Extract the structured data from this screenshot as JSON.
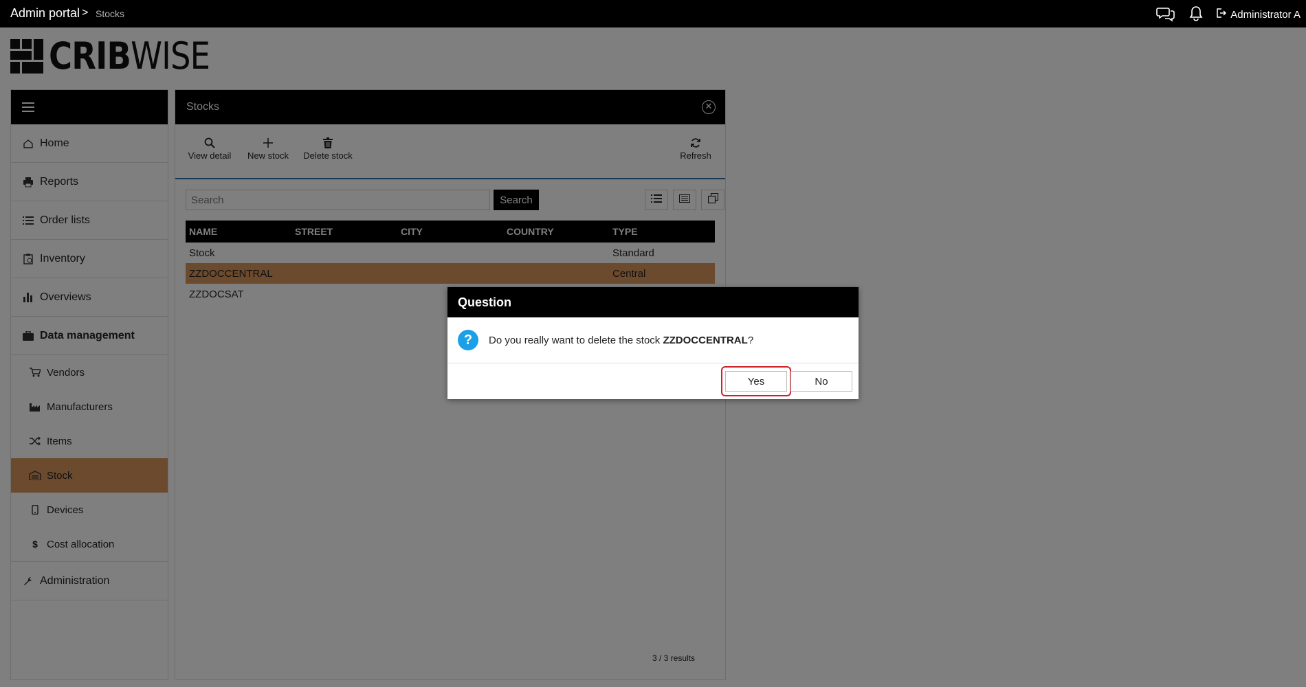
{
  "topbar": {
    "breadcrumb_root": "Admin portal",
    "breadcrumb_sep": ">",
    "breadcrumb_current": "Stocks",
    "user_name": "Administrator A",
    "icons": [
      "chat-icon",
      "bell-icon",
      "logout-icon"
    ]
  },
  "logo": {
    "bold": "CRIB",
    "light": "WISE"
  },
  "sidebar": {
    "items": [
      {
        "label": "Home",
        "icon": "home-icon"
      },
      {
        "label": "Reports",
        "icon": "printer-icon"
      },
      {
        "label": "Order lists",
        "icon": "list-icon"
      },
      {
        "label": "Inventory",
        "icon": "clipboard-icon"
      },
      {
        "label": "Overviews",
        "icon": "bar-chart-icon"
      },
      {
        "label": "Data management",
        "icon": "briefcase-icon"
      }
    ],
    "sub_items": [
      {
        "label": "Vendors",
        "icon": "cart-icon"
      },
      {
        "label": "Manufacturers",
        "icon": "factory-icon"
      },
      {
        "label": "Items",
        "icon": "shuffle-icon"
      },
      {
        "label": "Stock",
        "icon": "warehouse-icon"
      },
      {
        "label": "Devices",
        "icon": "mobile-icon"
      },
      {
        "label": "Cost allocation",
        "icon": "dollar-icon"
      }
    ],
    "admin": {
      "label": "Administration",
      "icon": "wrench-icon"
    }
  },
  "panel": {
    "title": "Stocks",
    "toolbar": {
      "view_detail": "View detail",
      "new_stock": "New stock",
      "delete_stock": "Delete stock",
      "refresh": "Refresh"
    },
    "search": {
      "placeholder": "Search",
      "button": "Search"
    },
    "table": {
      "columns": [
        "NAME",
        "STREET",
        "CITY",
        "COUNTRY",
        "TYPE"
      ],
      "rows": [
        [
          "Stock",
          "",
          "",
          "",
          "Standard"
        ],
        [
          "ZZDOCCENTRAL",
          "",
          "",
          "",
          "Central"
        ],
        [
          "ZZDOCSAT",
          "",
          "",
          "",
          ""
        ]
      ],
      "selected_row": 1
    },
    "results": "3 / 3 results"
  },
  "dialog": {
    "title": "Question",
    "message_prefix": "Do you really want to delete the stock ",
    "message_bold": "ZZDOCCENTRAL",
    "message_suffix": "?",
    "yes": "Yes",
    "no": "No"
  },
  "colors": {
    "accent": "#d9955c",
    "header": "#000000",
    "highlight": "#d0202a",
    "info": "#1aa0e6"
  }
}
